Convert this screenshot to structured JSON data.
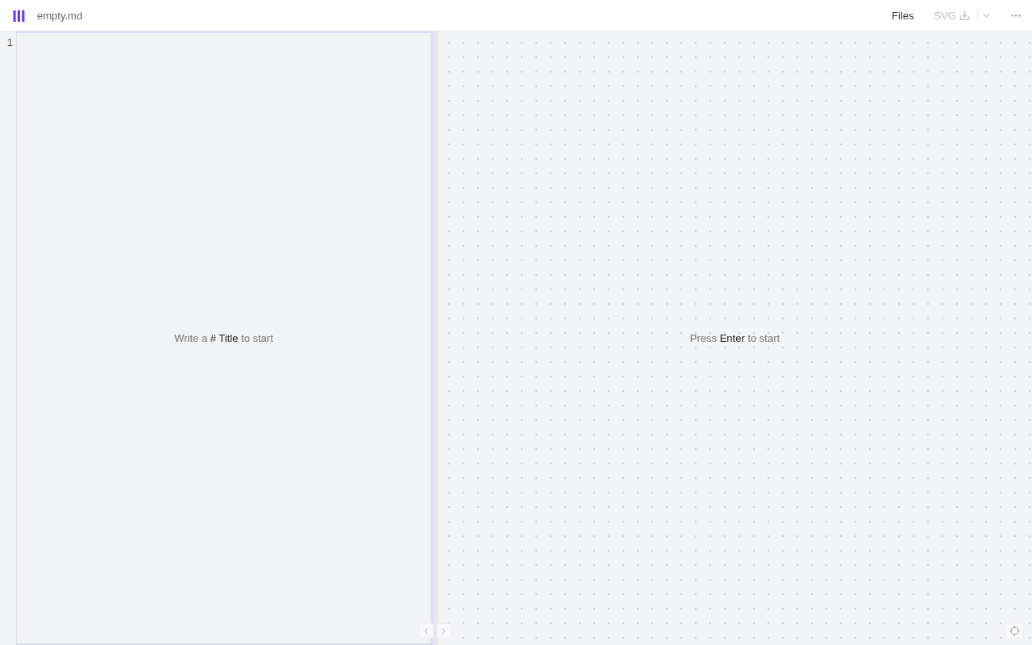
{
  "header": {
    "file_name": "empty.md",
    "actions": [
      {
        "kind": "link",
        "label": "Files",
        "disabled": false
      },
      {
        "kind": "export",
        "label": "SVG",
        "disabled": true
      }
    ]
  },
  "editor": {
    "line_numbers": [
      "1"
    ],
    "focused": true,
    "empty_hint": "Write a **# Title** to start"
  },
  "canvas": {
    "empty_hint": "Press **Enter** to start"
  }
}
